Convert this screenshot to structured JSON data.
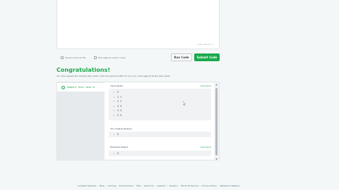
{
  "editor": {
    "status": "Line: 18 Col: 2"
  },
  "actions": {
    "upload_label": "Upload Code as File",
    "custom_input_label": "Test against custom input",
    "run_label": "Run Code",
    "submit_label": "Submit Code"
  },
  "result": {
    "title": "Congratulations!",
    "subtitle": "You have passed the sample test cases. Click the submit button to run your code against all the test cases.",
    "test_case_label": "Sample Test case 0",
    "input_label": "Input (stdin)",
    "download_label": "Download",
    "input_lines": [
      {
        "num": "1",
        "text": "5"
      },
      {
        "num": "2",
        "text": "1 1"
      },
      {
        "num": "3",
        "text": "2 2"
      },
      {
        "num": "4",
        "text": "3 3"
      },
      {
        "num": "5",
        "text": "4 4"
      },
      {
        "num": "6",
        "text": "5 5"
      }
    ],
    "output_label": "Your Output (stdout)",
    "output_lines": [
      {
        "num": "1",
        "text": "5"
      }
    ],
    "expected_label": "Expected Output",
    "expected_lines": [
      {
        "num": "1",
        "text": "5"
      }
    ]
  },
  "footer": {
    "links": [
      "Contest Calendar",
      "Blog",
      "Scoring",
      "Environment",
      "FAQ",
      "About Us",
      "Support",
      "Careers",
      "Terms Of Service",
      "Privacy Policy",
      "Request a Feature"
    ]
  },
  "colors": {
    "accent": "#1ba94c",
    "background": "#f3f7f7"
  }
}
